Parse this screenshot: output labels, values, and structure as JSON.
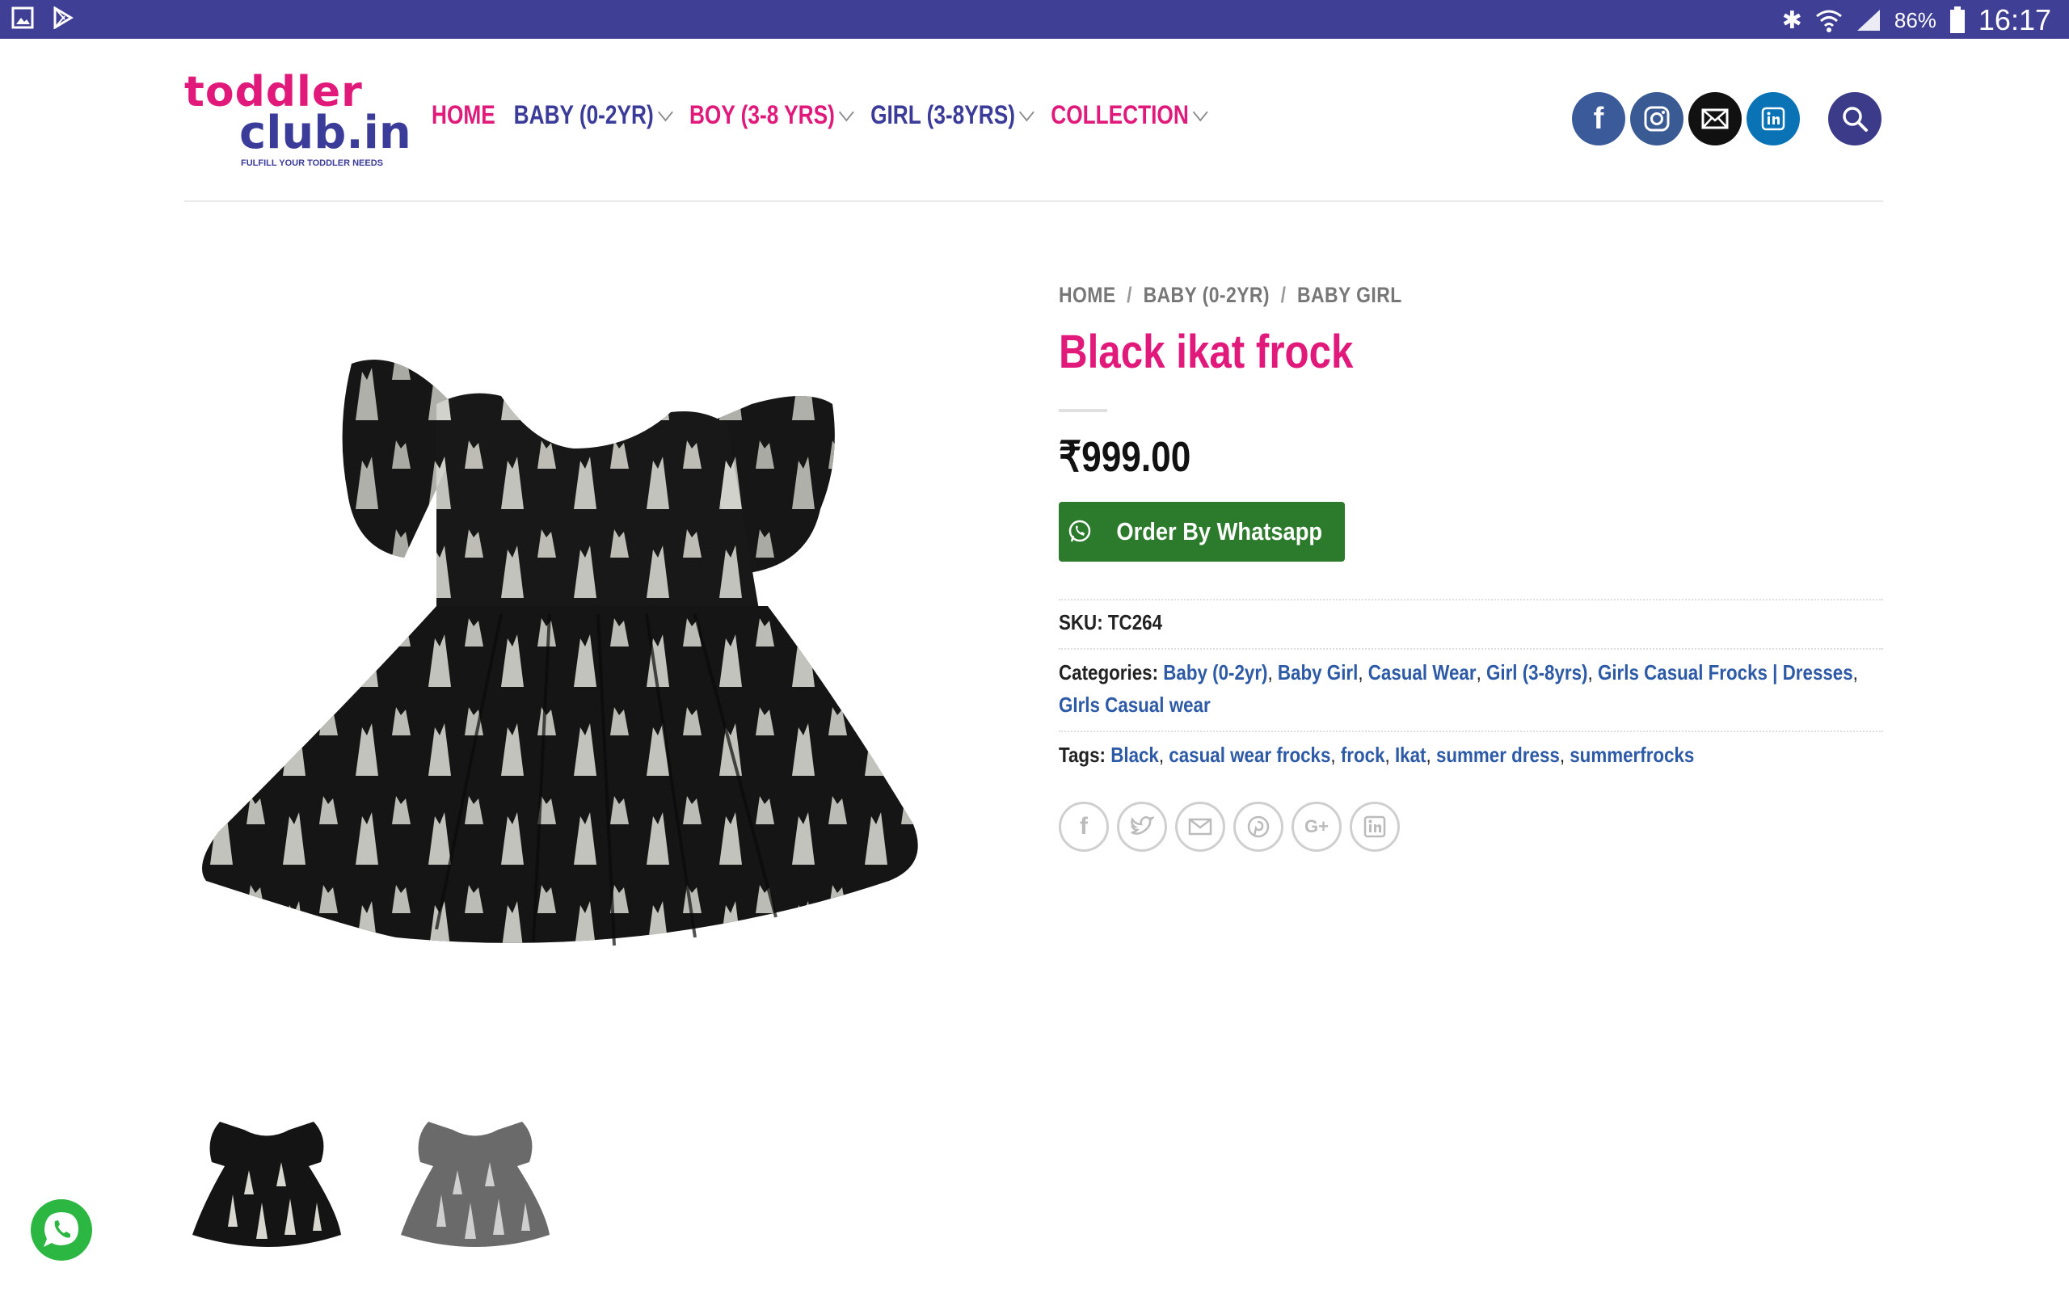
{
  "status_bar": {
    "battery": "86%",
    "clock": "16:17"
  },
  "logo": {
    "line1": "toddler",
    "line2": "club.in",
    "tagline": "FULFILL YOUR TODDLER NEEDS"
  },
  "nav": {
    "items": [
      {
        "label": "HOME",
        "dropdown": false,
        "color": "#e0197a"
      },
      {
        "label": "BABY (0-2YR)",
        "dropdown": true,
        "color": "#3b3b9a"
      },
      {
        "label": "BOY (3-8 YRS)",
        "dropdown": true,
        "color": "#e0197a"
      },
      {
        "label": "GIRL (3-8YRS)",
        "dropdown": true,
        "color": "#3b3b9a"
      },
      {
        "label": "COLLECTION",
        "dropdown": true,
        "color": "#e0197a"
      }
    ]
  },
  "header_icons": [
    "facebook-icon",
    "instagram-icon",
    "email-icon",
    "linkedin-icon",
    "search-icon"
  ],
  "breadcrumb": {
    "items": [
      "HOME",
      "BABY (0-2YR)",
      "BABY GIRL"
    ],
    "separator": "/"
  },
  "product": {
    "title": "Black ikat frock",
    "price": "₹999.00",
    "order_button": "Order By Whatsapp",
    "sku_label": "SKU:",
    "sku": "TC264",
    "categories_label": "Categories:",
    "categories": [
      "Baby (0-2yr)",
      "Baby Girl",
      "Casual Wear",
      "Girl (3-8yrs)",
      "Girls Casual Frocks | Dresses",
      "GIrls Casual wear"
    ],
    "tags_label": "Tags:",
    "tags": [
      "Black",
      "casual wear frocks",
      "frock",
      "Ikat",
      "summer dress",
      "summerfrocks"
    ]
  },
  "share_icons": [
    "facebook-icon",
    "twitter-icon",
    "email-icon",
    "pinterest-icon",
    "google-plus-icon",
    "linkedin-icon"
  ],
  "colors": {
    "brand_pink": "#e0197a",
    "brand_blue": "#3b3b9a",
    "link_blue": "#2d5aa6",
    "whatsapp_green": "#2c7a2c",
    "status_bar": "#3f3f95"
  }
}
